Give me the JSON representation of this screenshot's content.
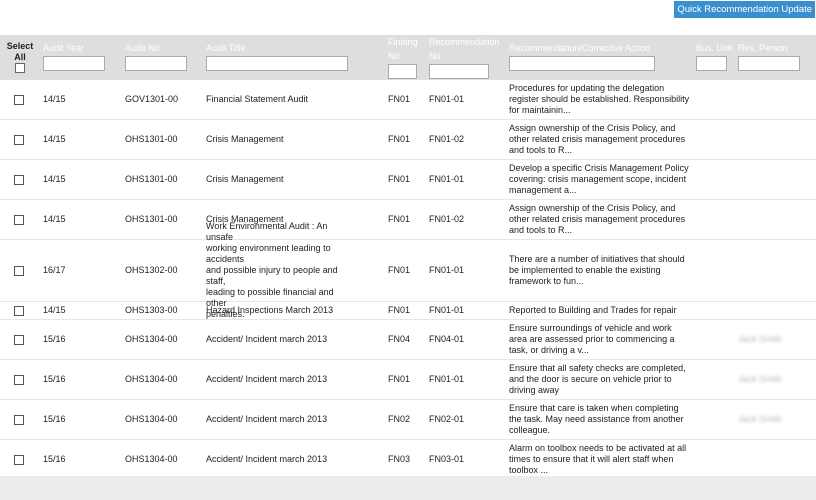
{
  "toolbar": {
    "quick_update_label": "Quick Recommendation Update"
  },
  "header": {
    "select_all": [
      "Select",
      "All"
    ],
    "audit_year": "Audit Year",
    "audit_no": "Audit No",
    "audit_title": "Audit Title",
    "finding_no": [
      "Finding",
      "No"
    ],
    "recommendation_no": [
      "Recommendation",
      "No"
    ],
    "recommendation": "Recommendation/Corrective Action",
    "bus_unit": "Bus. Unit",
    "res_person": "Res. Person"
  },
  "rows": [
    {
      "year": "14/15",
      "audit_no": "GOV1301-00",
      "title": [
        "Financial Statement Audit"
      ],
      "finding": "FN01",
      "rec_no": "FN01-01",
      "rec": [
        "Procedures for updating the delegation",
        "register should be established. Responsibility",
        "for maintainin..."
      ],
      "person": ""
    },
    {
      "year": "14/15",
      "audit_no": "OHS1301-00",
      "title": [
        "Crisis Management"
      ],
      "finding": "FN01",
      "rec_no": "FN01-02",
      "rec": [
        "Assign ownership of the Crisis Policy, and",
        "other related crisis management procedures",
        "and tools to R..."
      ],
      "person": ""
    },
    {
      "year": "14/15",
      "audit_no": "OHS1301-00",
      "title": [
        "Crisis Management"
      ],
      "finding": "FN01",
      "rec_no": "FN01-01",
      "rec": [
        "Develop a specific Crisis Management Policy",
        "covering: crisis management scope, incident",
        "management a..."
      ],
      "person": ""
    },
    {
      "year": "14/15",
      "audit_no": "OHS1301-00",
      "title": [
        "Crisis Management"
      ],
      "finding": "FN01",
      "rec_no": "FN01-02",
      "rec": [
        "Assign ownership of the Crisis Policy, and",
        "other related crisis management procedures",
        "and tools to R..."
      ],
      "person": ""
    },
    {
      "year": "16/17",
      "audit_no": "OHS1302-00",
      "title": [
        "Work Environmental Audit : An unsafe",
        "working environment leading to accidents",
        "and possible injury to people and staff,",
        "leading to possible financial and other",
        "penalties."
      ],
      "finding": "FN01",
      "rec_no": "FN01-01",
      "rec": [
        "There are a number of initiatives that should",
        "be implemented to enable the existing",
        "framework to fun..."
      ],
      "person": ""
    },
    {
      "year": "14/15",
      "audit_no": "OHS1303-00",
      "title": [
        "Hazard Inspections March 2013"
      ],
      "finding": "FN01",
      "rec_no": "FN01-01",
      "rec": [
        "Reported to Building and Trades for repair"
      ],
      "person": ""
    },
    {
      "year": "15/16",
      "audit_no": "OHS1304-00",
      "title": [
        "Accident/ Incident march 2013"
      ],
      "finding": "FN04",
      "rec_no": "FN04-01",
      "rec": [
        "Ensure surroundings of vehicle and work",
        "area are assessed prior to commencing a",
        "task, or driving a v..."
      ],
      "person": "Jack Smith"
    },
    {
      "year": "15/16",
      "audit_no": "OHS1304-00",
      "title": [
        "Accident/ Incident march 2013"
      ],
      "finding": "FN01",
      "rec_no": "FN01-01",
      "rec": [
        "Ensure that all safety checks are completed,",
        "and the door is secure on vehicle prior to",
        "driving away"
      ],
      "person": "Jack Smith"
    },
    {
      "year": "15/16",
      "audit_no": "OHS1304-00",
      "title": [
        "Accident/ Incident march 2013"
      ],
      "finding": "FN02",
      "rec_no": "FN02-01",
      "rec": [
        "Ensure that care is taken when completing",
        "the task. May need assistance from another",
        "colleague."
      ],
      "person": "Jack Smith"
    },
    {
      "year": "15/16",
      "audit_no": "OHS1304-00",
      "title": [
        "Accident/ Incident march 2013"
      ],
      "finding": "FN03",
      "rec_no": "FN03-01",
      "rec": [
        "Alarm on toolbox needs to be activated at all",
        "times to ensure that it will alert staff when",
        "toolbox ..."
      ],
      "person": ""
    }
  ]
}
